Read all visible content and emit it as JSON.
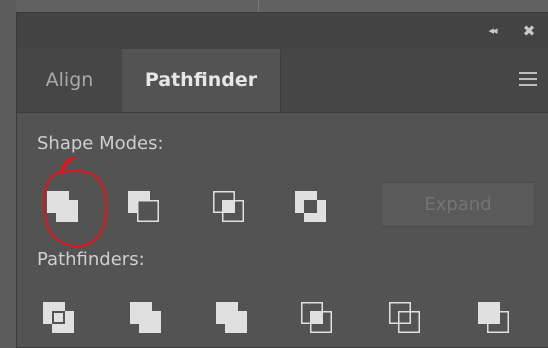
{
  "window": {
    "collapse_glyph": "◂◂",
    "close_glyph": "✖"
  },
  "tabs": [
    {
      "label": "Align",
      "active": false
    },
    {
      "label": "Pathfinder",
      "active": true
    }
  ],
  "sections": {
    "shape_modes": {
      "label": "Shape Modes:",
      "buttons": [
        "unite-icon",
        "minus-front-icon",
        "intersect-icon",
        "exclude-icon"
      ],
      "expand_label": "Expand"
    },
    "pathfinders": {
      "label": "Pathfinders:",
      "buttons": [
        "divide-icon",
        "trim-icon",
        "merge-icon",
        "crop-icon",
        "outline-icon",
        "minus-back-icon"
      ]
    }
  },
  "colors": {
    "panel_bg": "#535353",
    "icon_fill": "#e0e0e0",
    "annotation": "#e0151b"
  }
}
